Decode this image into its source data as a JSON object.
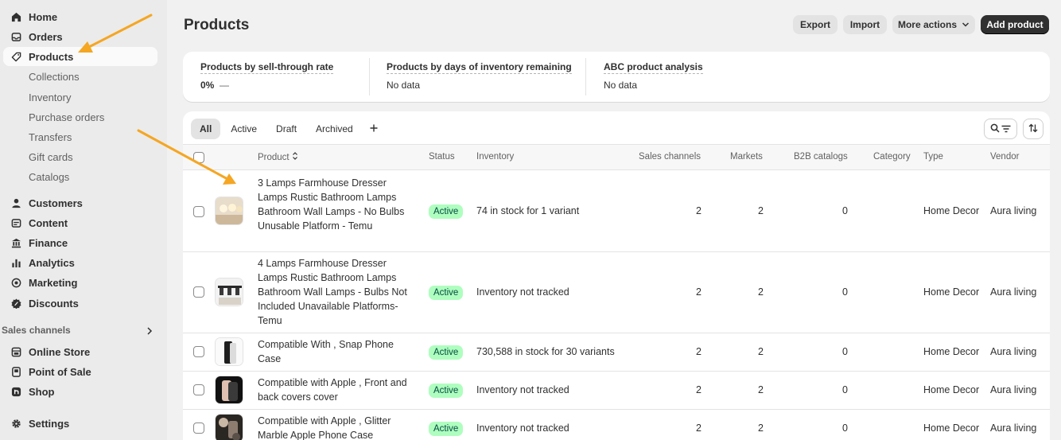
{
  "sidebar": {
    "main_items": [
      {
        "label": "Home",
        "icon": "home-icon"
      },
      {
        "label": "Orders",
        "icon": "inbox-icon"
      },
      {
        "label": "Products",
        "icon": "tag-icon",
        "active": true
      }
    ],
    "product_subitems": [
      "Collections",
      "Inventory",
      "Purchase orders",
      "Transfers",
      "Gift cards",
      "Catalogs"
    ],
    "other_items": [
      {
        "label": "Customers",
        "icon": "person-icon"
      },
      {
        "label": "Content",
        "icon": "image-icon"
      },
      {
        "label": "Finance",
        "icon": "bank-icon"
      },
      {
        "label": "Analytics",
        "icon": "bar-chart-icon"
      },
      {
        "label": "Marketing",
        "icon": "target-icon"
      },
      {
        "label": "Discounts",
        "icon": "discount-icon"
      }
    ],
    "sales_channels_label": "Sales channels",
    "channels": [
      {
        "label": "Online Store",
        "icon": "store-icon"
      },
      {
        "label": "Point of Sale",
        "icon": "pos-icon"
      },
      {
        "label": "Shop",
        "icon": "shop-icon"
      }
    ],
    "settings_label": "Settings"
  },
  "header": {
    "title": "Products",
    "export_label": "Export",
    "import_label": "Import",
    "more_actions_label": "More actions",
    "add_product_label": "Add product"
  },
  "metrics": [
    {
      "title": "Products by sell-through rate",
      "value": "0%",
      "trend": "—"
    },
    {
      "title": "Products by days of inventory remaining",
      "value": "No data"
    },
    {
      "title": "ABC product analysis",
      "value": "No data"
    }
  ],
  "tabs": [
    "All",
    "Active",
    "Draft",
    "Archived"
  ],
  "columns": {
    "product": "Product",
    "status": "Status",
    "inventory": "Inventory",
    "sales_channels": "Sales channels",
    "markets": "Markets",
    "b2b_catalogs": "B2B catalogs",
    "category": "Category",
    "type": "Type",
    "vendor": "Vendor"
  },
  "rows": [
    {
      "name": "3 Lamps Farmhouse Dresser Lamps Rustic Bathroom Lamps Bathroom Wall Lamps - No Bulbs Unusable Platform - Temu",
      "status": "Active",
      "inventory": "74 in stock for 1 variant",
      "sales_channels": "2",
      "markets": "2",
      "b2b": "0",
      "category": "",
      "type": "Home Decor",
      "vendor": "Aura living"
    },
    {
      "name": "4 Lamps Farmhouse Dresser Lamps Rustic Bathroom Lamps Bathroom Wall Lamps - Bulbs Not Included Unavailable Platforms- Temu",
      "status": "Active",
      "inventory": "Inventory not tracked",
      "sales_channels": "2",
      "markets": "2",
      "b2b": "0",
      "category": "",
      "type": "Home Decor",
      "vendor": "Aura living"
    },
    {
      "name": "Compatible With , Snap Phone Case",
      "status": "Active",
      "inventory": "730,588 in stock for 30 variants",
      "sales_channels": "2",
      "markets": "2",
      "b2b": "0",
      "category": "",
      "type": "Home Decor",
      "vendor": "Aura living"
    },
    {
      "name": "Compatible with Apple , Front and back covers cover",
      "status": "Active",
      "inventory": "Inventory not tracked",
      "sales_channels": "2",
      "markets": "2",
      "b2b": "0",
      "category": "",
      "type": "Home Decor",
      "vendor": "Aura living"
    },
    {
      "name": "Compatible with Apple , Glitter Marble Apple Phone Case",
      "status": "Active",
      "inventory": "Inventory not tracked",
      "sales_channels": "2",
      "markets": "2",
      "b2b": "0",
      "category": "",
      "type": "Home Decor",
      "vendor": "Aura living"
    }
  ],
  "colors": {
    "active_badge_bg": "#affebf",
    "active_badge_text": "#014b40",
    "primary_button": "#303030",
    "annotation_arrow": "#f5a623"
  }
}
